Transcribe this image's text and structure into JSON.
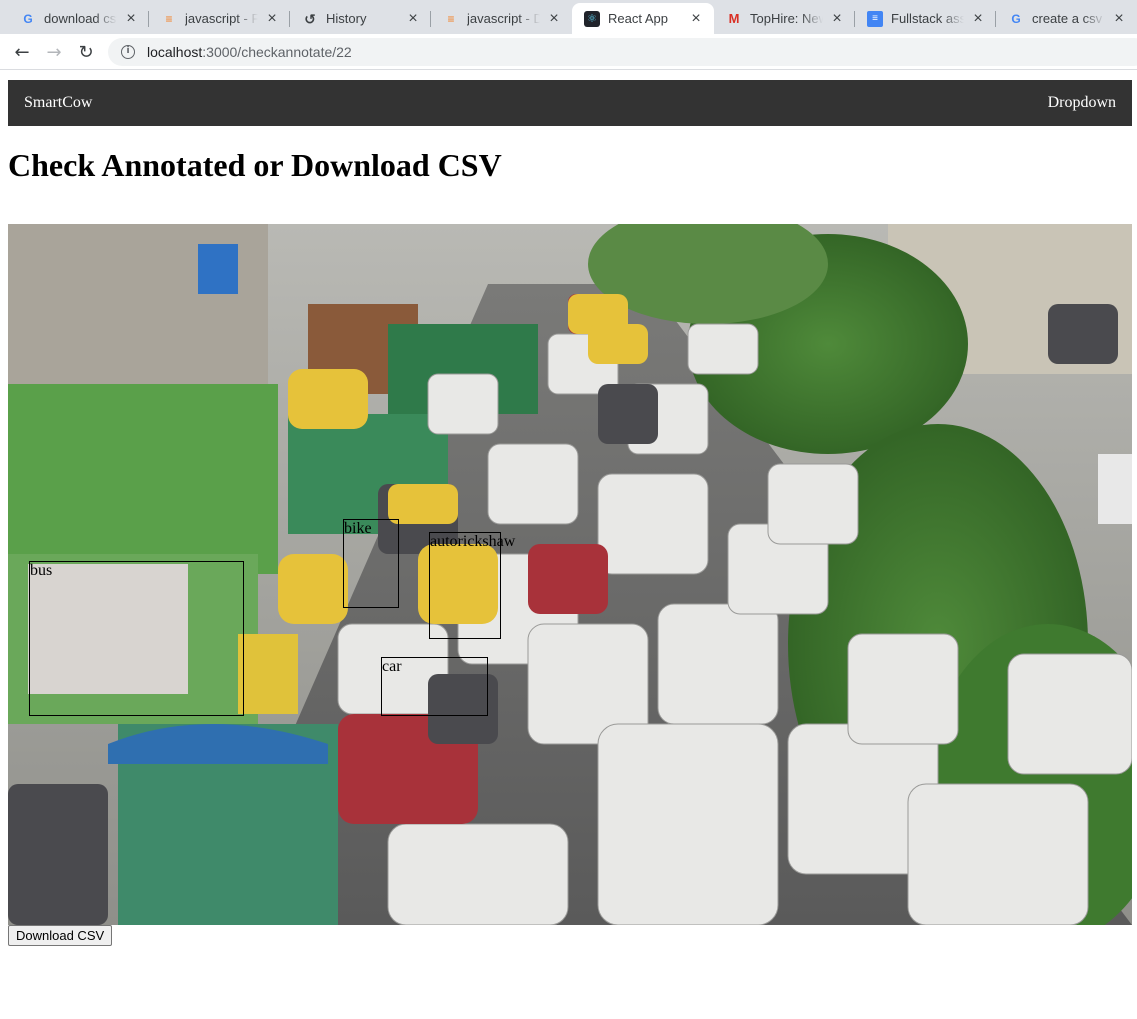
{
  "browser": {
    "tabs": [
      {
        "title": "download csv",
        "favicon": "google-icon"
      },
      {
        "title": "javascript - Fi",
        "favicon": "stackoverflow-icon"
      },
      {
        "title": "History",
        "favicon": "history-icon"
      },
      {
        "title": "javascript - D",
        "favicon": "stackoverflow-icon"
      },
      {
        "title": "React App",
        "favicon": "react-icon",
        "active": true
      },
      {
        "title": "TopHire: New",
        "favicon": "gmail-icon"
      },
      {
        "title": "Fullstack assi",
        "favicon": "docs-icon"
      },
      {
        "title": "create a csv f",
        "favicon": "google-icon"
      }
    ],
    "url_host": "localhost",
    "url_path": ":3000/checkannotate/22"
  },
  "navbar": {
    "brand": "SmartCow",
    "dropdown": "Dropdown",
    "background": "#333333"
  },
  "page": {
    "title": "Check Annotated or Download CSV",
    "download_button": "Download CSV"
  },
  "annotations": [
    {
      "label": "bike"
    },
    {
      "label": "autorickshaw"
    },
    {
      "label": "bus"
    },
    {
      "label": "car"
    }
  ]
}
